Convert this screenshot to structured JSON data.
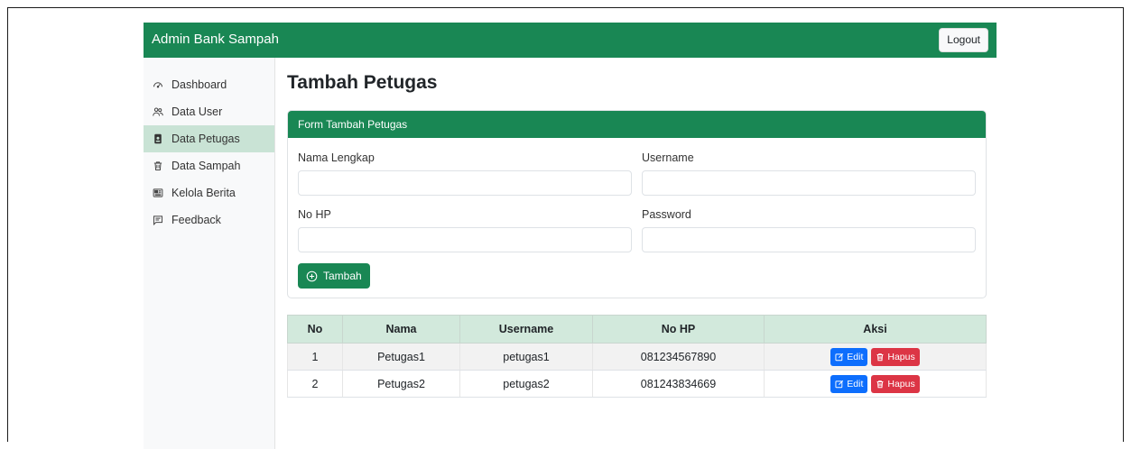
{
  "navbar": {
    "brand": "Admin Bank Sampah",
    "logout_label": "Logout"
  },
  "sidebar": {
    "items": [
      {
        "label": "Dashboard",
        "icon": "speedometer-icon",
        "active": false
      },
      {
        "label": "Data User",
        "icon": "people-icon",
        "active": false
      },
      {
        "label": "Data Petugas",
        "icon": "person-badge-icon",
        "active": true
      },
      {
        "label": "Data Sampah",
        "icon": "trash-icon",
        "active": false
      },
      {
        "label": "Kelola Berita",
        "icon": "newspaper-icon",
        "active": false
      },
      {
        "label": "Feedback",
        "icon": "chat-left-text-icon",
        "active": false
      }
    ]
  },
  "page": {
    "title": "Tambah Petugas"
  },
  "form": {
    "header": "Form Tambah Petugas",
    "fields": {
      "nama_lengkap": {
        "label": "Nama Lengkap",
        "value": ""
      },
      "username": {
        "label": "Username",
        "value": ""
      },
      "no_hp": {
        "label": "No HP",
        "value": ""
      },
      "password": {
        "label": "Password",
        "value": ""
      }
    },
    "submit_label": "Tambah"
  },
  "table": {
    "headers": [
      "No",
      "Nama",
      "Username",
      "No HP",
      "Aksi"
    ],
    "rows": [
      {
        "no": "1",
        "nama": "Petugas1",
        "username": "petugas1",
        "no_hp": "081234567890"
      },
      {
        "no": "2",
        "nama": "Petugas2",
        "username": "petugas2",
        "no_hp": "081243834669"
      }
    ],
    "edit_label": "Edit",
    "hapus_label": "Hapus"
  },
  "colors": {
    "primary_green": "#198754",
    "active_nav": "#c9e3d5",
    "table_header": "#d2e9dc",
    "edit_blue": "#0d6efd",
    "delete_red": "#dc3545"
  }
}
